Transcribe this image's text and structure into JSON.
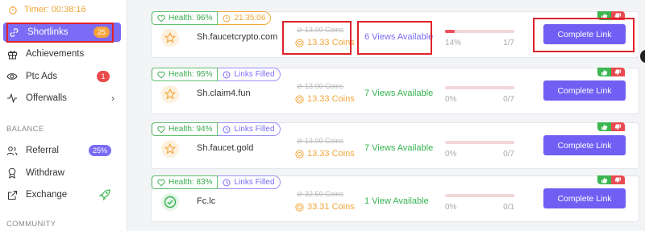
{
  "timer": {
    "label": "Timer: 00:38:16"
  },
  "sidebar": {
    "items": [
      {
        "label": "Shortlinks",
        "badge": "25"
      },
      {
        "label": "Achievements"
      },
      {
        "label": "Ptc Ads",
        "badge": "1"
      },
      {
        "label": "Offerwalls",
        "chevron": "›"
      }
    ],
    "balance_label": "BALANCE",
    "balance_items": [
      {
        "label": "Referral",
        "badge": "25%"
      },
      {
        "label": "Withdraw"
      },
      {
        "label": "Exchange"
      }
    ],
    "community_label": "COMMUNITY"
  },
  "cards": [
    {
      "health": "Health: 96%",
      "status": "21:35:06",
      "site": "Sh.faucetcrypto.com",
      "coins_old": "13.00 Coins",
      "coins_new": "13.33 Coins",
      "views": "6 Views Available",
      "progress_pct": "14%",
      "progress_value": 0.14,
      "progress_frac": "1/7",
      "button": "Complete Link"
    },
    {
      "health": "Health: 95%",
      "status": "Links Filled",
      "site": "Sh.claim4.fun",
      "coins_old": "13.00 Coins",
      "coins_new": "13.33 Coins",
      "views": "7 Views Available",
      "progress_pct": "0%",
      "progress_value": 0,
      "progress_frac": "0/7",
      "button": "Complete Link"
    },
    {
      "health": "Health: 94%",
      "status": "Links Filled",
      "site": "Sh.faucet.gold",
      "coins_old": "13.00 Coins",
      "coins_new": "13.33 Coins",
      "views": "7 Views Available",
      "progress_pct": "0%",
      "progress_value": 0,
      "progress_frac": "0/7",
      "button": "Complete Link"
    },
    {
      "health": "Health: 83%",
      "status": "Links Filled",
      "site": "Fc.lc",
      "coins_old": "32.50 Coins",
      "coins_new": "33.31 Coins",
      "views": "1 View Available",
      "progress_pct": "0%",
      "progress_value": 0,
      "progress_frac": "0/1",
      "button": "Complete Link"
    }
  ],
  "colors": {
    "accent": "#6f5ff3",
    "green": "#35b24f",
    "orange": "#f1a53a",
    "red": "#ea4a52",
    "highlight": "#e0222a"
  }
}
